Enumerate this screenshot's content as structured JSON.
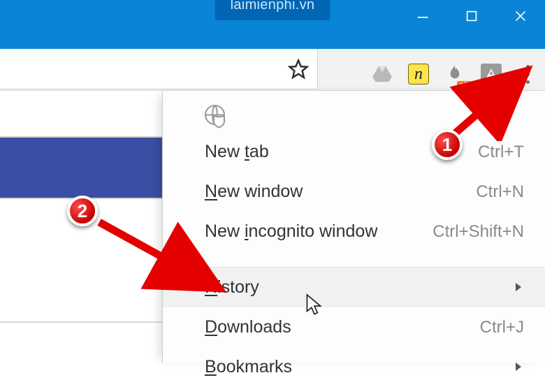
{
  "titlebar": {
    "site_hint": "laimienphi.vn"
  },
  "extension_labels": {
    "n_mark": "n",
    "off_badge": "off"
  },
  "menu": {
    "items": [
      {
        "label_pre": "New ",
        "accel_char": "t",
        "label_post": "ab",
        "shortcut": "Ctrl+T",
        "submenu": false,
        "hover": false
      },
      {
        "label_pre": "",
        "accel_char": "N",
        "label_post": "ew window",
        "shortcut": "Ctrl+N",
        "submenu": false,
        "hover": false
      },
      {
        "label_pre": "New ",
        "accel_char": "i",
        "label_post": "ncognito window",
        "shortcut": "Ctrl+Shift+N",
        "submenu": false,
        "hover": false
      }
    ],
    "items2": [
      {
        "label_pre": "",
        "accel_char": "H",
        "label_post": "istory",
        "shortcut": "",
        "submenu": true,
        "hover": true
      },
      {
        "label_pre": "",
        "accel_char": "D",
        "label_post": "ownloads",
        "shortcut": "Ctrl+J",
        "submenu": false,
        "hover": false
      },
      {
        "label_pre": "",
        "accel_char": "B",
        "label_post": "ookmarks",
        "shortcut": "",
        "submenu": true,
        "hover": false
      }
    ]
  },
  "annotations": {
    "step1": "1",
    "step2": "2"
  }
}
